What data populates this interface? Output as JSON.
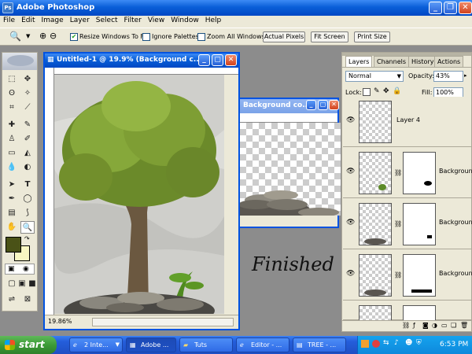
{
  "app": {
    "title": "Adobe Photoshop",
    "icon": "photoshop-icon"
  },
  "menu": [
    "File",
    "Edit",
    "Image",
    "Layer",
    "Select",
    "Filter",
    "View",
    "Window",
    "Help"
  ],
  "options": {
    "resize_windows_label": "Resize Windows To Fit",
    "resize_windows_checked": true,
    "ignore_palettes_label": "Ignore Palettes",
    "ignore_palettes_checked": false,
    "zoom_all_label": "Zoom All Windows",
    "zoom_all_checked": false,
    "actual_pixels": "Actual Pixels",
    "fit_screen": "Fit Screen",
    "print_size": "Print Size"
  },
  "doc1": {
    "title": "Untitled-1 @ 19.9% (Background c...",
    "zoom_status": "19.86%"
  },
  "doc2": {
    "title": "Background co..."
  },
  "overlay_text": "Finished",
  "layers_panel": {
    "tabs": [
      "Layers",
      "Channels",
      "History",
      "Actions"
    ],
    "blend_mode": "Normal",
    "opacity_label": "Opacity:",
    "opacity_value": "43%",
    "lock_label": "Lock:",
    "fill_label": "Fill:",
    "fill_value": "100%",
    "layers": [
      {
        "name": "Layer 4"
      },
      {
        "name": "Background"
      },
      {
        "name": "Background"
      },
      {
        "name": "Background"
      }
    ]
  },
  "taskbar": {
    "start_label": "start",
    "tasks": [
      "2 Inte...",
      "Adobe ...",
      "Tuts",
      "Editor - ...",
      "TREE - ..."
    ],
    "clock": "6:53 PM"
  },
  "colors": {
    "foreground": "#4a5217",
    "background": "#f8f7c2",
    "titlebar": "#0a5fd8"
  }
}
